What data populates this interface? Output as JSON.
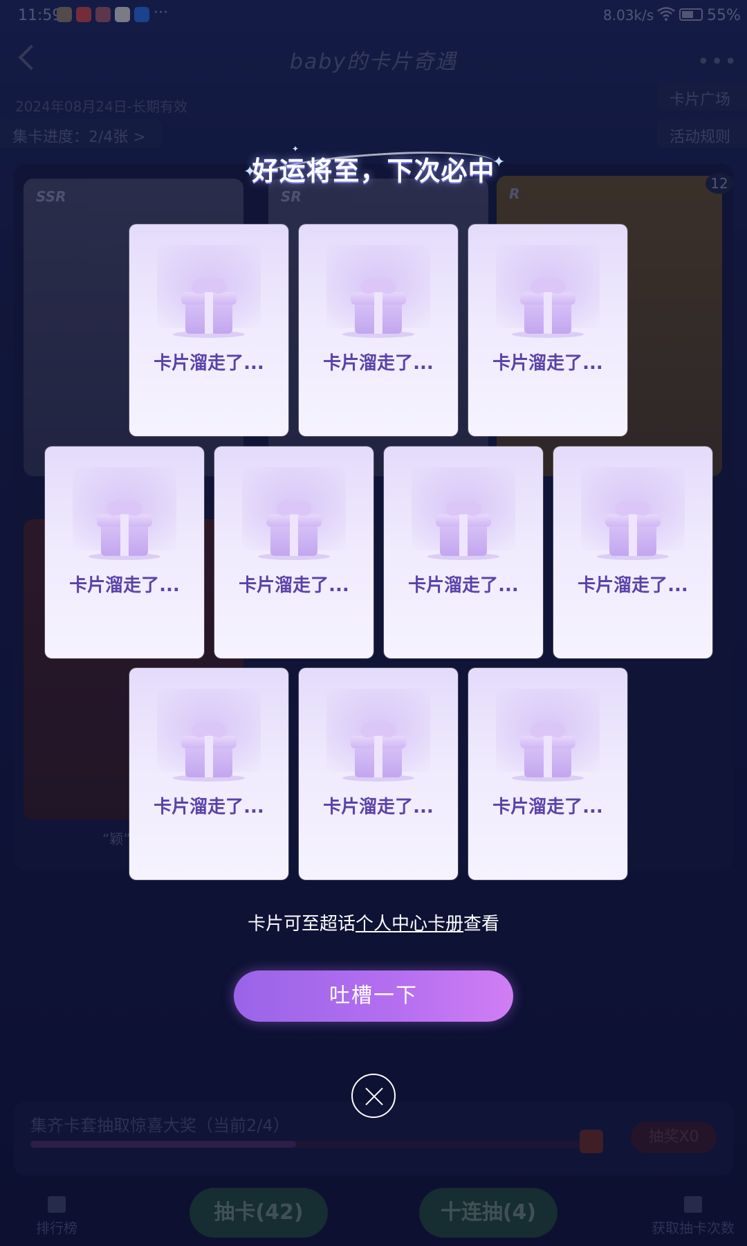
{
  "status_bar": {
    "time": "11:59",
    "more": "···",
    "net_speed": "8.03k/s",
    "battery": "55%"
  },
  "header": {
    "title": "baby的卡片奇遇",
    "menu": "•••"
  },
  "activity": {
    "date_range": "2024年08月24日-长期有效",
    "progress": "集卡进度：2/4张 >",
    "card_square": "卡片广场",
    "rules": "活动规则"
  },
  "background_cards": [
    {
      "tag": "SSR"
    },
    {
      "tag": "SR"
    },
    {
      "tag": "R"
    },
    {
      "tag": ""
    }
  ],
  "badge_count": "12",
  "quote_label": "“颖”",
  "bottom": {
    "collect_text": "集齐卡套抽取惊喜大奖（当前2/4）",
    "progress_fraction": 0.48,
    "lottery": "抽奖X0",
    "rank": "排行榜",
    "draw_one": "抽卡(42)",
    "draw_ten": "十连抽(4)",
    "get_count": "获取抽卡次数"
  },
  "modal": {
    "banner": "好运将至，下次必中",
    "cards": [
      {
        "label": "卡片溜走了..."
      },
      {
        "label": "卡片溜走了..."
      },
      {
        "label": "卡片溜走了..."
      },
      {
        "label": "卡片溜走了..."
      },
      {
        "label": "卡片溜走了..."
      },
      {
        "label": "卡片溜走了..."
      },
      {
        "label": "卡片溜走了..."
      },
      {
        "label": "卡片溜走了..."
      },
      {
        "label": "卡片溜走了..."
      },
      {
        "label": "卡片溜走了..."
      }
    ],
    "hint_prefix": "卡片可至超话",
    "hint_link": "个人中心卡册",
    "hint_suffix": "查看",
    "complain_button": "吐槽一下"
  }
}
